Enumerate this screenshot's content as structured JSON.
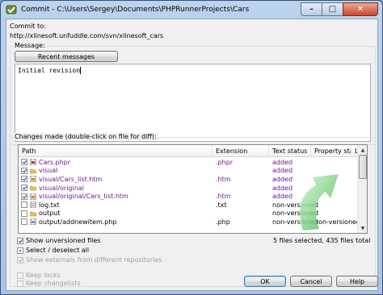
{
  "window": {
    "title": "Commit - C:\\Users\\Sergey\\Documents\\PHPRunnerProjects\\Cars",
    "minimize_label": "–",
    "maximize_label": "□",
    "close_label": "✕"
  },
  "commit": {
    "commit_to_label": "Commit to:",
    "url": "http://xlinesoft.unfuddle.com/svn/xlinesoft_cars"
  },
  "message": {
    "group_label": "Message:",
    "recent_button": "Recent messages",
    "text": "Initial revision"
  },
  "changes": {
    "group_label": "Changes made (double-click on file for diff):",
    "columns": [
      "Path",
      "Extension",
      "Text status",
      "Property status",
      "Lo"
    ],
    "rows": [
      {
        "checked": true,
        "icon": "php-file-icon",
        "path": "Cars.phpr",
        "ext": ".phpr",
        "status": "added",
        "prop": ""
      },
      {
        "checked": true,
        "icon": "folder-icon",
        "path": "visual",
        "ext": "",
        "status": "added",
        "prop": ""
      },
      {
        "checked": true,
        "icon": "html-file-icon",
        "path": "visual/Cars_list.htm",
        "ext": ".htm",
        "status": "added",
        "prop": ""
      },
      {
        "checked": true,
        "icon": "folder-icon",
        "path": "visual/original",
        "ext": "",
        "status": "added",
        "prop": ""
      },
      {
        "checked": true,
        "icon": "html-file-icon",
        "path": "visual/original/Cars_list.htm",
        "ext": ".htm",
        "status": "added",
        "prop": ""
      },
      {
        "checked": false,
        "icon": "text-file-icon",
        "path": "log.txt",
        "ext": ".txt",
        "status": "non-versioned",
        "prop": ""
      },
      {
        "checked": false,
        "icon": "folder-icon",
        "path": "output",
        "ext": "",
        "status": "non-versioned",
        "prop": ""
      },
      {
        "checked": false,
        "icon": "php-file-icon",
        "path": "output/addnewitem.php",
        "ext": ".php",
        "status": "non-versioned",
        "prop": "non-versioned"
      }
    ],
    "summary": "5 files selected, 435 files total"
  },
  "options": {
    "show_unversioned": "Show unversioned files",
    "show_unversioned_checked": true,
    "select_all": "Select / deselect all",
    "select_all_state": "indeterminate",
    "show_externals": "Show externals from different repositories",
    "show_externals_checked": true,
    "keep_locks": "Keep locks",
    "keep_changelists": "Keep changelists"
  },
  "buttons": {
    "ok": "OK",
    "cancel": "Cancel",
    "help": "Help"
  },
  "colors": {
    "added_status": "#6a1b8a",
    "titlebar": "#bcd3ee",
    "arrow_green": "#3bb54a"
  }
}
